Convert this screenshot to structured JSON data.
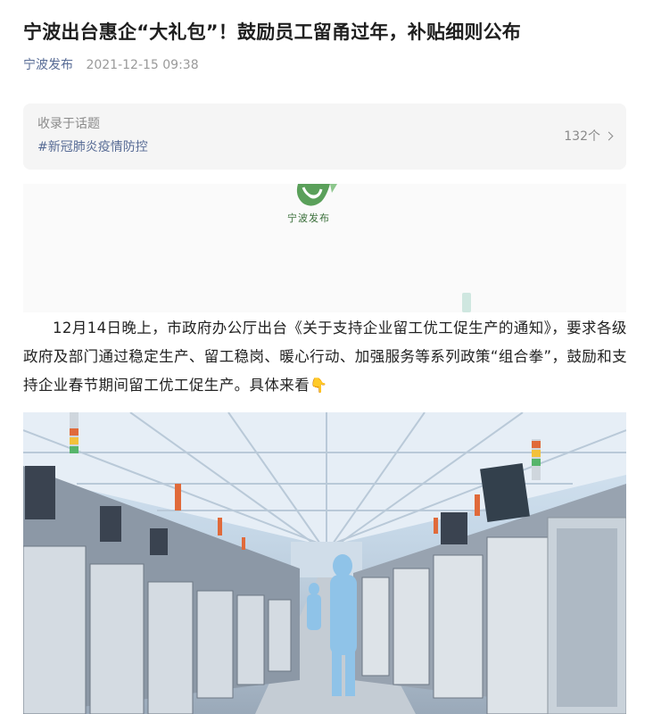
{
  "article": {
    "title": "宁波出台惠企“大礼包”！鼓励员工留甬过年，补贴细则公布",
    "source": "宁波发布",
    "time": "2021-12-15 09:38"
  },
  "topic": {
    "label": "收录于话题",
    "tag": "#新冠肺炎疫情防控",
    "count": "132个"
  },
  "logo": {
    "text": "宁波发布",
    "color": "#2e7d32"
  },
  "body": {
    "paragraph": "12月14日晚上，市政府办公厅出台《关于支持企业留工优工促生产的通知》，要求各级政府及部门通过稳定生产、留工稳岗、暖心行动、加强服务等系列政策“组合拳”，鼓励和支持企业春节期间留工优工促生产。具体来看",
    "emoji": "👇"
  },
  "icons": {
    "topic_arrow": "chevron-right-icon"
  }
}
